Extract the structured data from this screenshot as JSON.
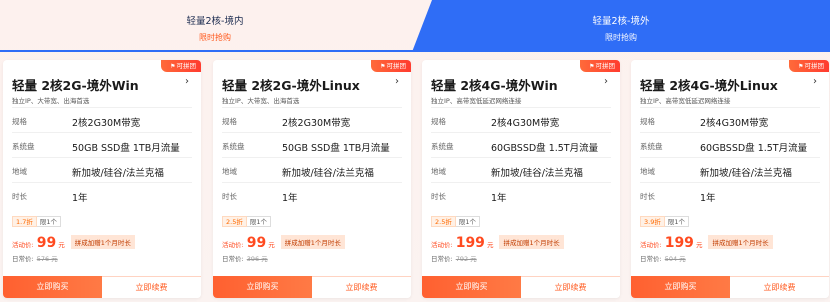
{
  "tabs": [
    {
      "title": "轻量2核-境内",
      "sub": "限时抢购"
    },
    {
      "title": "轻量2核-境外",
      "sub": "限时抢购"
    }
  ],
  "badge": "可拼团",
  "labels": {
    "spec": "规格",
    "disk": "系统盘",
    "region": "地域",
    "duration": "时长",
    "activity": "活动价:",
    "daily": "日常价:",
    "unit": "元",
    "buy": "立即购买",
    "renew": "立即续费"
  },
  "cards": [
    {
      "title": "轻量 2核2G-境外Win",
      "subtitle": "独立IP、大带宽、出海首选",
      "spec": "2核2G30M带宽",
      "disk": "50GB SSD盘 1TB月流量",
      "region": "新加坡/硅谷/法兰克福",
      "duration": "1年",
      "discount": "1.7折",
      "limit": "限1个",
      "price": "99",
      "promo": "拼成加赠1个月时长",
      "orig": "576 元"
    },
    {
      "title": "轻量 2核2G-境外Linux",
      "subtitle": "独立IP、大带宽、出海首选",
      "spec": "2核2G30M带宽",
      "disk": "50GB SSD盘 1TB月流量",
      "region": "新加坡/硅谷/法兰克福",
      "duration": "1年",
      "discount": "2.5折",
      "limit": "限1个",
      "price": "99",
      "promo": "拼成加赠1个月时长",
      "orig": "396 元"
    },
    {
      "title": "轻量 2核4G-境外Win",
      "subtitle": "独立IP、高带宽低延迟网络连接",
      "spec": "2核4G30M带宽",
      "disk": "60GBSSD盘 1.5T月流量",
      "region": "新加坡/硅谷/法兰克福",
      "duration": "1年",
      "discount": "2.5折",
      "limit": "限1个",
      "price": "199",
      "promo": "拼成加赠1个月时长",
      "orig": "792 元"
    },
    {
      "title": "轻量 2核4G-境外Linux",
      "subtitle": "独立IP、高带宽低延迟网络连接",
      "spec": "2核4G30M带宽",
      "disk": "60GBSSD盘 1.5T月流量",
      "region": "新加坡/硅谷/法兰克福",
      "duration": "1年",
      "discount": "3.9折",
      "limit": "限1个",
      "price": "199",
      "promo": "拼成加赠1个月时长",
      "orig": "504 元"
    }
  ]
}
